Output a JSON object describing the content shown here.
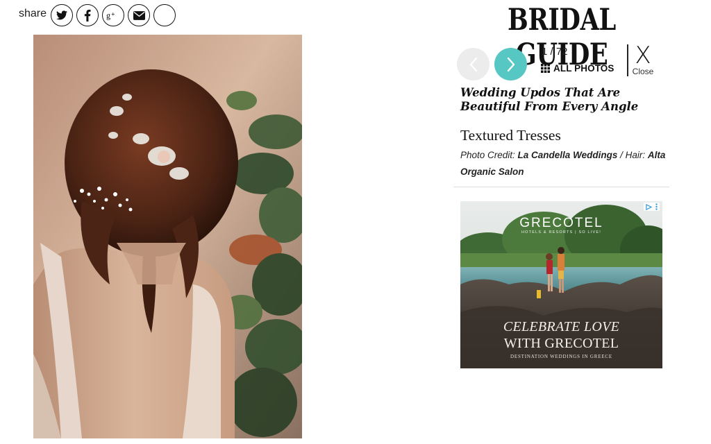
{
  "share": {
    "label": "share",
    "buttons": [
      {
        "icon": "twitter-icon"
      },
      {
        "icon": "facebook-icon"
      },
      {
        "icon": "google-plus-icon"
      },
      {
        "icon": "email-icon"
      },
      {
        "icon": "blank-circle"
      }
    ]
  },
  "brand": {
    "logo": "BRIDAL GUIDE"
  },
  "gallery": {
    "counter": "1 / 72",
    "all_photos_label": "ALL PHOTOS",
    "close_label": "Close",
    "close_glyph": "X",
    "title": "Wedding Updos That Are Beautiful From Every Angle",
    "slide_title": "Textured Tresses",
    "credit": {
      "photo_prefix": "Photo Credit: ",
      "photo_name": "La Candella Weddings",
      "separator": " / ",
      "hair_prefix": "Hair: ",
      "hair_name": "Alta Organic Salon"
    },
    "accent_color": "#57c7c4"
  },
  "ad": {
    "brand": "GRECOTEL",
    "brand_sub": "HOTELS & RESORTS | SO LIVE!",
    "headline_1": "CELEBRATE LOVE",
    "headline_2": "WITH GRECOTEL",
    "tagline": "DESTINATION WEDDINGS IN GREECE"
  }
}
